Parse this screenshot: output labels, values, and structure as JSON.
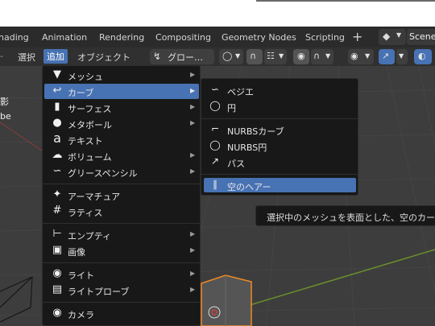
{
  "workspace_tabs": [
    {
      "label": "hading"
    },
    {
      "label": "Animation"
    },
    {
      "label": "Rendering"
    },
    {
      "label": "Compositing"
    },
    {
      "label": "Geometry Nodes"
    },
    {
      "label": "Scripting"
    }
  ],
  "workspace_add": "+",
  "scene": {
    "icon": "scene-icon",
    "label": "Scene"
  },
  "header": {
    "dash": "-",
    "select": "選択",
    "add": "追加",
    "object": "オブジェクト",
    "transform_orientation": "グロー…"
  },
  "viewport": {
    "side_text_1": "影",
    "side_text_2": "be"
  },
  "add_menu": {
    "items": [
      {
        "icon": "mesh-icon",
        "label": "メッシュ",
        "submenu": true
      },
      {
        "icon": "curve-icon",
        "label": "カーブ",
        "submenu": true,
        "highlighted": true
      },
      {
        "icon": "surface-icon",
        "label": "サーフェス",
        "submenu": true
      },
      {
        "icon": "metaball-icon",
        "label": "メタボール",
        "submenu": true
      },
      {
        "icon": "text-icon",
        "label": "テキスト",
        "submenu": false
      },
      {
        "icon": "volume-icon",
        "label": "ボリューム",
        "submenu": true
      },
      {
        "icon": "grease-pencil-icon",
        "label": "グリースペンシル",
        "submenu": true
      },
      {
        "icon": "armature-icon",
        "label": "アーマチュア",
        "submenu": false
      },
      {
        "icon": "lattice-icon",
        "label": "ラティス",
        "submenu": false
      },
      {
        "icon": "empty-icon",
        "label": "エンプティ",
        "submenu": true
      },
      {
        "icon": "image-icon",
        "label": "画像",
        "submenu": true
      },
      {
        "icon": "light-icon",
        "label": "ライト",
        "submenu": true
      },
      {
        "icon": "light-probe-icon",
        "label": "ライトプローブ",
        "submenu": true
      },
      {
        "icon": "camera-icon",
        "label": "カメラ",
        "submenu": false
      }
    ]
  },
  "curve_submenu": {
    "items": [
      {
        "icon": "bezier-icon",
        "label": "ベジエ"
      },
      {
        "icon": "circle-curve-icon",
        "label": "円"
      },
      {
        "icon": "nurbs-curve-icon",
        "label": "NURBSカーブ"
      },
      {
        "icon": "nurbs-circle-icon",
        "label": "NURBS円"
      },
      {
        "icon": "path-icon",
        "label": "パス"
      },
      {
        "icon": "empty-hair-icon",
        "label": "空のヘアー",
        "highlighted": true
      }
    ]
  },
  "tooltip": {
    "text": "選択中のメッシュを表面とした、空のカー"
  }
}
